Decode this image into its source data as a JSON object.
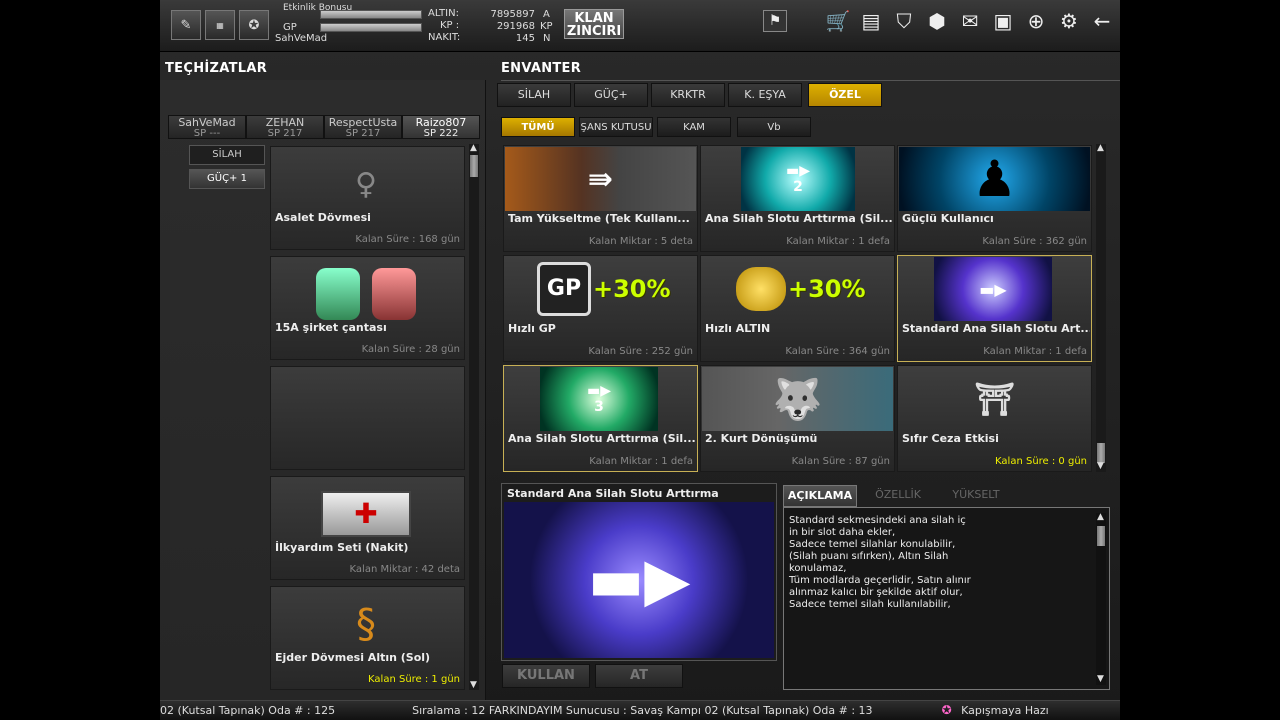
{
  "topbar": {
    "event_bonus": "Etkinlik Bonusu",
    "gp_label": "GP",
    "username": "SahVeMad",
    "altin_label": "ALTIN:",
    "kp_label": "KP :",
    "nakit_label": "NAKIT:",
    "altin_value": "7895897",
    "kp_value": "291968",
    "nakit_value": "145",
    "altin_unit": "A",
    "kp_unit": "KP",
    "nakit_unit": "N",
    "clan_label_1": "KLAN",
    "clan_label_2": "ZINCIRI"
  },
  "left": {
    "title": "TEÇHİZATLAR",
    "players": [
      {
        "name": "SahVeMad",
        "sp": "SP ---"
      },
      {
        "name": "ZEHAN",
        "sp": "SP 217"
      },
      {
        "name": "RespectUsta",
        "sp": "SP 217"
      },
      {
        "name": "Raizo807",
        "sp": "SP 222"
      }
    ],
    "categories": [
      "SİLAH",
      "GÜÇ+ 1"
    ],
    "items": [
      {
        "name": "Asalet Dövmesi",
        "sub": "Kalan Süre : 168 gün"
      },
      {
        "name": "15A şirket çantası",
        "sub": "Kalan Süre : 28 gün"
      },
      {
        "name": "",
        "sub": ""
      },
      {
        "name": "İlkyardım Seti (Nakit)",
        "sub": "Kalan Miktar : 42 deta"
      },
      {
        "name": "Ejder Dövmesi Altın (Sol)",
        "sub": "Kalan Süre : 1 gün"
      }
    ]
  },
  "right": {
    "title": "ENVANTER",
    "tabs": [
      "SİLAH",
      "GÜÇ+",
      "KRKTR",
      "K. EŞYA",
      "ÖZEL"
    ],
    "subtabs": [
      "TÜMÜ",
      "ŞANS KUTUSU",
      "KAM",
      "Vb"
    ],
    "items": [
      {
        "name": "Tam Yükseltme (Tek Kullanı...",
        "sub": "Kalan Miktar : 5 deta"
      },
      {
        "name": "Ana Silah Slotu Arttırma (Sil...",
        "sub": "Kalan Miktar : 1 defa"
      },
      {
        "name": "Güçlü Kullanıcı",
        "sub": "Kalan Süre : 362 gün"
      },
      {
        "name": "Hızlı GP",
        "sub": "Kalan Süre : 252 gün"
      },
      {
        "name": "Hızlı ALTIN",
        "sub": "Kalan Süre : 364 gün"
      },
      {
        "name": "Standard Ana Silah Slotu Art...",
        "sub": "Kalan Miktar : 1 defa"
      },
      {
        "name": "Ana Silah Slotu Arttırma (Sil...",
        "sub": "Kalan Miktar : 1 defa"
      },
      {
        "name": "2. Kurt Dönüşümü",
        "sub": "Kalan Süre : 87 gün"
      },
      {
        "name": "Sıfır Ceza Etkisi",
        "sub": "Kalan Süre : 0 gün"
      }
    ],
    "badges": {
      "gp": "GP",
      "boost": "+30%",
      "slot2": "2",
      "slot3": "3"
    }
  },
  "detail": {
    "title": "Standard Ana Silah Slotu Arttırma",
    "tabs": [
      "AÇIKLAMA",
      "ÖZELLİK",
      "YÜKSELT"
    ],
    "use_button": "KULLAN",
    "drop_button": "AT",
    "description": [
      "Standard sekmesindeki ana silah iç",
      "in bir slot daha ekler,",
      "Sadece temel silahlar konulabilir,",
      "(Silah puanı sıfırken), Altın Silah",
      "konulamaz,",
      "Tüm modlarda geçerlidir, Satın alınır",
      " alınmaz kalıcı bir şekilde aktif olur,",
      "Sadece temel silah kullanılabilir,"
    ]
  },
  "ticker": {
    "part1": "02 (Kutsal Tapınak) Oda # : 125",
    "part2": "Sıralama : 12 FARKINDAYIM Sunucusu : Savaş Kampı 02 (Kutsal Tapınak) Oda # : 13",
    "part3": "Kapışmaya Hazı"
  }
}
